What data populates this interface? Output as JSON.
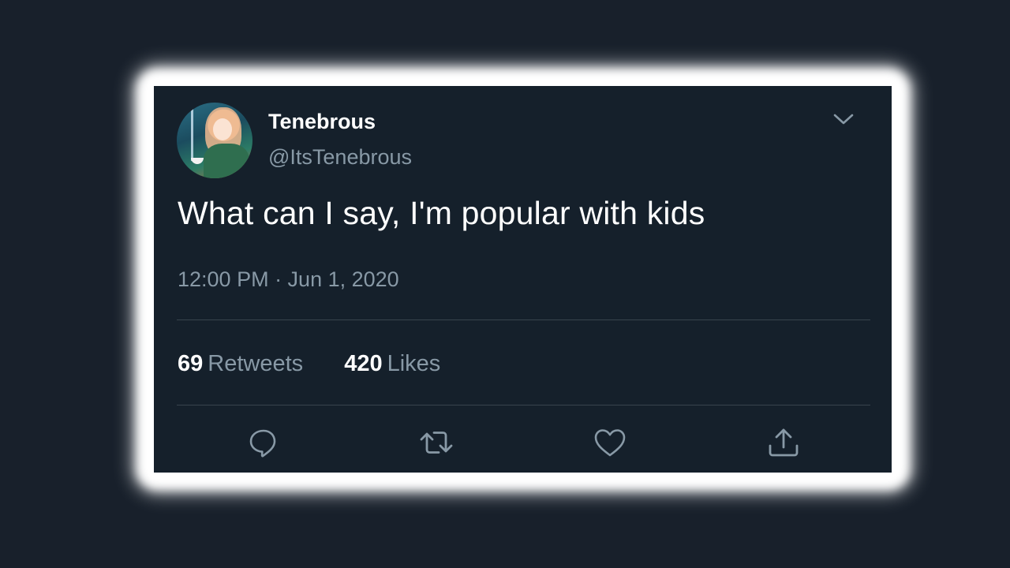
{
  "tweet": {
    "display_name": "Tenebrous",
    "handle": "@ItsTenebrous",
    "text": "What can I say, I'm popular with kids",
    "timestamp": "12:00 PM · Jun 1, 2020",
    "stats": {
      "retweets_count": "69",
      "retweets_label": "Retweets",
      "likes_count": "420",
      "likes_label": "Likes"
    },
    "actions": [
      {
        "icon": "reply-icon"
      },
      {
        "icon": "retweet-icon"
      },
      {
        "icon": "like-icon"
      },
      {
        "icon": "share-icon"
      }
    ],
    "menu_icon": "chevron-down-icon"
  },
  "colors": {
    "background": "#18202b",
    "card": "#15202b",
    "primary_text": "#ffffff",
    "secondary_text": "#8899a6",
    "divider": "#38444d",
    "frame": "#ffffff"
  }
}
